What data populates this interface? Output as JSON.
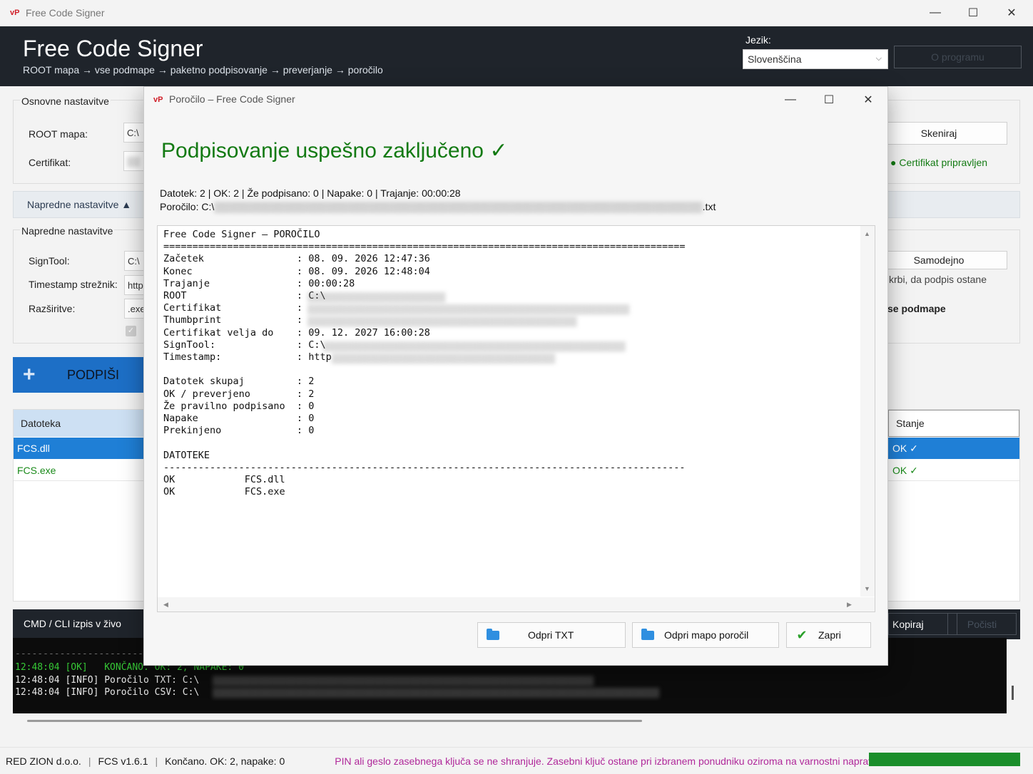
{
  "window": {
    "icon_text": "vP",
    "title": "Free Code Signer",
    "controls": {
      "minimize": "—",
      "maximize": "☐",
      "close": "✕"
    }
  },
  "header": {
    "title": "Free Code Signer",
    "subtitle": "ROOT mapa → vse podmape → paketno podpisovanje → preverjanje → poročilo",
    "language_label": "Jezik:",
    "language_value": "Slovenščina",
    "about_label": "O programu"
  },
  "basic": {
    "group_title": "Osnovne nastavitve",
    "root_label": "ROOT mapa:",
    "root_value": "C:\\",
    "cert_label": "Certifikat:",
    "scan_label": "Skeniraj",
    "cert_status": "● Certifikat pripravljen"
  },
  "advanced": {
    "toggle_label": "Napredne nastavitve ▲",
    "group_title": "Napredne nastavitve",
    "signtool_label": "SignTool:",
    "signtool_value": "C:\\",
    "timestamp_label": "Timestamp strežnik:",
    "timestamp_value": "http",
    "ext_label": "Razširitve:",
    "ext_value": ".exe",
    "auto_label": "Samodejno",
    "note_fragment": "krbi, da podpis ostane",
    "subfolders_fragment": "se podmape"
  },
  "sign_button": {
    "icon": "+",
    "label": "PODPIŠI"
  },
  "table": {
    "col_file": "Datoteka",
    "col_status": "Stanje",
    "rows": [
      {
        "file": "FCS.dll",
        "status": "OK ✓"
      },
      {
        "file": "FCS.exe",
        "status": "OK ✓"
      }
    ]
  },
  "cli": {
    "title": "CMD / CLI izpis v živo",
    "copy_label": "Kopiraj",
    "clear_label": "Počisti",
    "lines": [
      "12:48:04 [OK]   KONČANO. OK: 2, NAPAKE: 0",
      "12:48:04 [INFO] Poročilo TXT: C:\\",
      "12:48:04 [INFO] Poročilo CSV: C:\\"
    ]
  },
  "statusbar": {
    "company": "RED ZION d.o.o.",
    "version": "FCS v1.6.1",
    "state": "Končano. OK: 2, napake: 0",
    "notice": "PIN ali geslo zasebnega ključa se ne shranjuje. Zasebni ključ ostane pri izbranem ponudniku oziroma na varnostni napravi.",
    "notice_color": "#b0289a",
    "progress": 1.0
  },
  "dialog": {
    "icon_text": "vP",
    "title": "Poročilo – Free Code Signer",
    "heading": "Podpisovanje uspešno zaključeno ✓",
    "heading_color": "#137a13",
    "summary": "Datotek: 2  |  OK: 2  |  Že podpisano: 0  |  Napake: 0  |  Trajanje: 00:00:28",
    "report_prefix": "Poročilo: C:\\",
    "report_suffix": ".txt",
    "report_lines": [
      "Free Code Signer – POROČILO",
      "==========================================================================================",
      "Začetek                : 08. 09. 2026 12:47:36",
      "Konec                  : 08. 09. 2026 12:48:04",
      "Trajanje               : 00:00:28",
      "ROOT                   : C:\\",
      "Certifikat             :",
      "Thumbprint             :",
      "Certifikat velja do    : 09. 12. 2027 16:00:28",
      "SignTool:              : C:\\",
      "Timestamp:             : http",
      "",
      "Datotek skupaj         : 2",
      "OK / preverjeno        : 2",
      "Že pravilno podpisano  : 0",
      "Napake                 : 0",
      "Prekinjeno             : 0",
      "",
      "DATOTEKE",
      "------------------------------------------------------------------------------------------",
      "OK            FCS.dll",
      "OK            FCS.exe"
    ],
    "btn_open_txt": "Odpri TXT",
    "btn_open_folder": "Odpri mapo poročil",
    "btn_close": "Zapri"
  }
}
